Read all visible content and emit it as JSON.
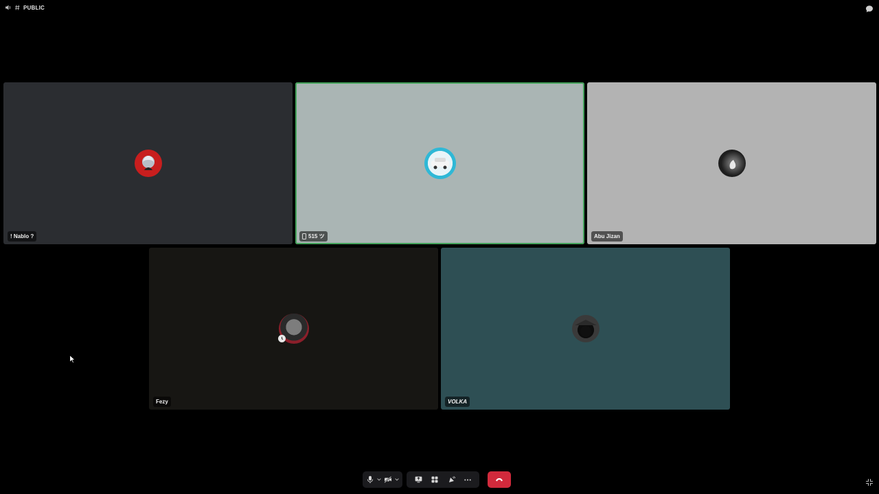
{
  "channel": {
    "icon": "speaker-icon",
    "prefix_icon": "hash-icon",
    "name": "PUBLIC"
  },
  "tiles": [
    {
      "name": "! Nablo ?",
      "bg": "#2b2d31",
      "speaking": false,
      "avatar_colors": [
        "#c81e1e",
        "#9aa0aa"
      ]
    },
    {
      "name": "515 ツ",
      "bg": "#aab5b4",
      "speaking": true,
      "device_icon": "mobile-phone-icon",
      "avatar_colors": [
        "#2fb8d6",
        "#f2f2f2"
      ]
    },
    {
      "name": "Abu Jizan",
      "bg": "#b3b3b3",
      "speaking": false,
      "avatar_colors": [
        "#202020",
        "#e0e0e0"
      ]
    },
    {
      "name": "Fezy",
      "bg": "#171613",
      "speaking": false,
      "badge_icon": "clock-icon",
      "avatar_colors": [
        "#a0202a",
        "#606060"
      ]
    },
    {
      "name": "VOLKA",
      "bg": "#2e4f54",
      "speaking": false,
      "avatar_colors": [
        "#1a1a1a",
        "#4a5a5a"
      ]
    }
  ],
  "controls": {
    "mic": "microphone-icon",
    "camera_off": "camera-off-icon",
    "screenshare": "screen-share-icon",
    "activities": "activities-icon",
    "soundboard": "soundboard-icon",
    "more": "more-icon",
    "leave": "hang-up-icon",
    "leave_color": "#d12a3c"
  },
  "accent_speaking": "#43a25a"
}
